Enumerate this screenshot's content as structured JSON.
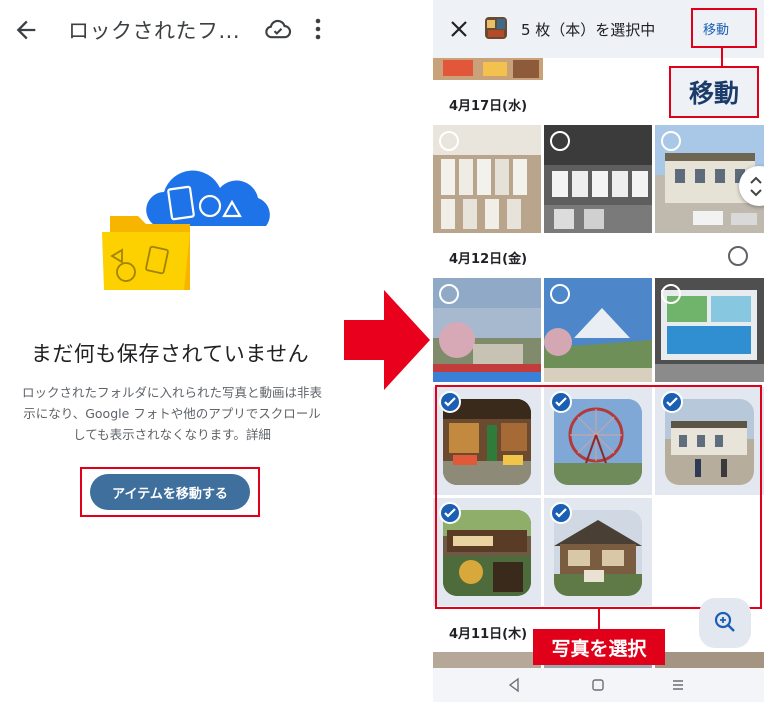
{
  "left": {
    "title": "ロックされたフ...",
    "empty_title": "まだ何も保存されていません",
    "description": "ロックされたフォルダに入れられた写真と動画は非表示になり、Google フォトや他のアプリでスクロールしても表示されなくなります。詳細",
    "move_items_button": "アイテムを移動する",
    "icons": [
      "back-arrow-icon",
      "cloud-check-icon",
      "more-vert-icon"
    ]
  },
  "right": {
    "selection_text": "5 枚（本）を選択中",
    "move_link": "移動",
    "move_callout": "移動",
    "sections": [
      {
        "date": "4月17日(水)"
      },
      {
        "date": "4月12日(金)"
      },
      {
        "date": "4月11日(木)"
      }
    ],
    "select_callout": "写真を選択",
    "selected_count": 5,
    "icons": [
      "close-icon",
      "scroll-handle-icon",
      "zoom-in-icon",
      "nav-back-icon",
      "nav-home-icon",
      "nav-recents-icon"
    ]
  },
  "colors": {
    "highlight_red": "#e0001a",
    "button_blue": "#3e6f9d",
    "selection_blue": "#1a5fb4"
  }
}
